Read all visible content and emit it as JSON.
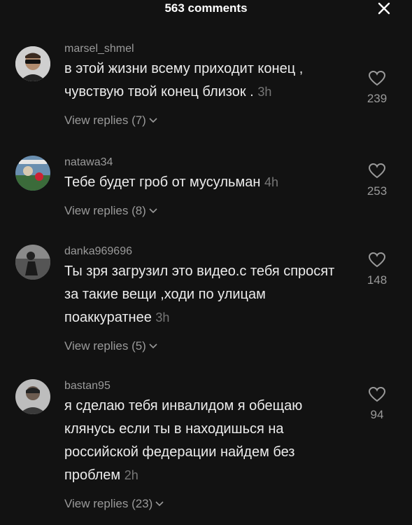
{
  "header": {
    "title": "563 comments"
  },
  "comments": [
    {
      "username": "marsel_shmel",
      "text": "в этой жизни всему приходит конец , чувствую твой конец близок .",
      "time": "3h",
      "replies": "View replies (7)",
      "likes": "239"
    },
    {
      "username": "natawa34",
      "text": "Тебе будет гроб от мусульман",
      "time": "4h",
      "replies": "View replies (8)",
      "likes": "253"
    },
    {
      "username": "danka969696",
      "text": "Ты зря загрузил это видео.с тебя спросят за такие вещи ,ходи по улицам поаккуратнее",
      "time": "3h",
      "replies": "View replies (5)",
      "likes": "148"
    },
    {
      "username": "bastan95",
      "text": "я сделаю тебя инвалидом я обещаю клянусь если ты в находишься на российской федерации найдем без проблем",
      "time": "2h",
      "replies": "View replies (23)",
      "likes": "94"
    }
  ]
}
